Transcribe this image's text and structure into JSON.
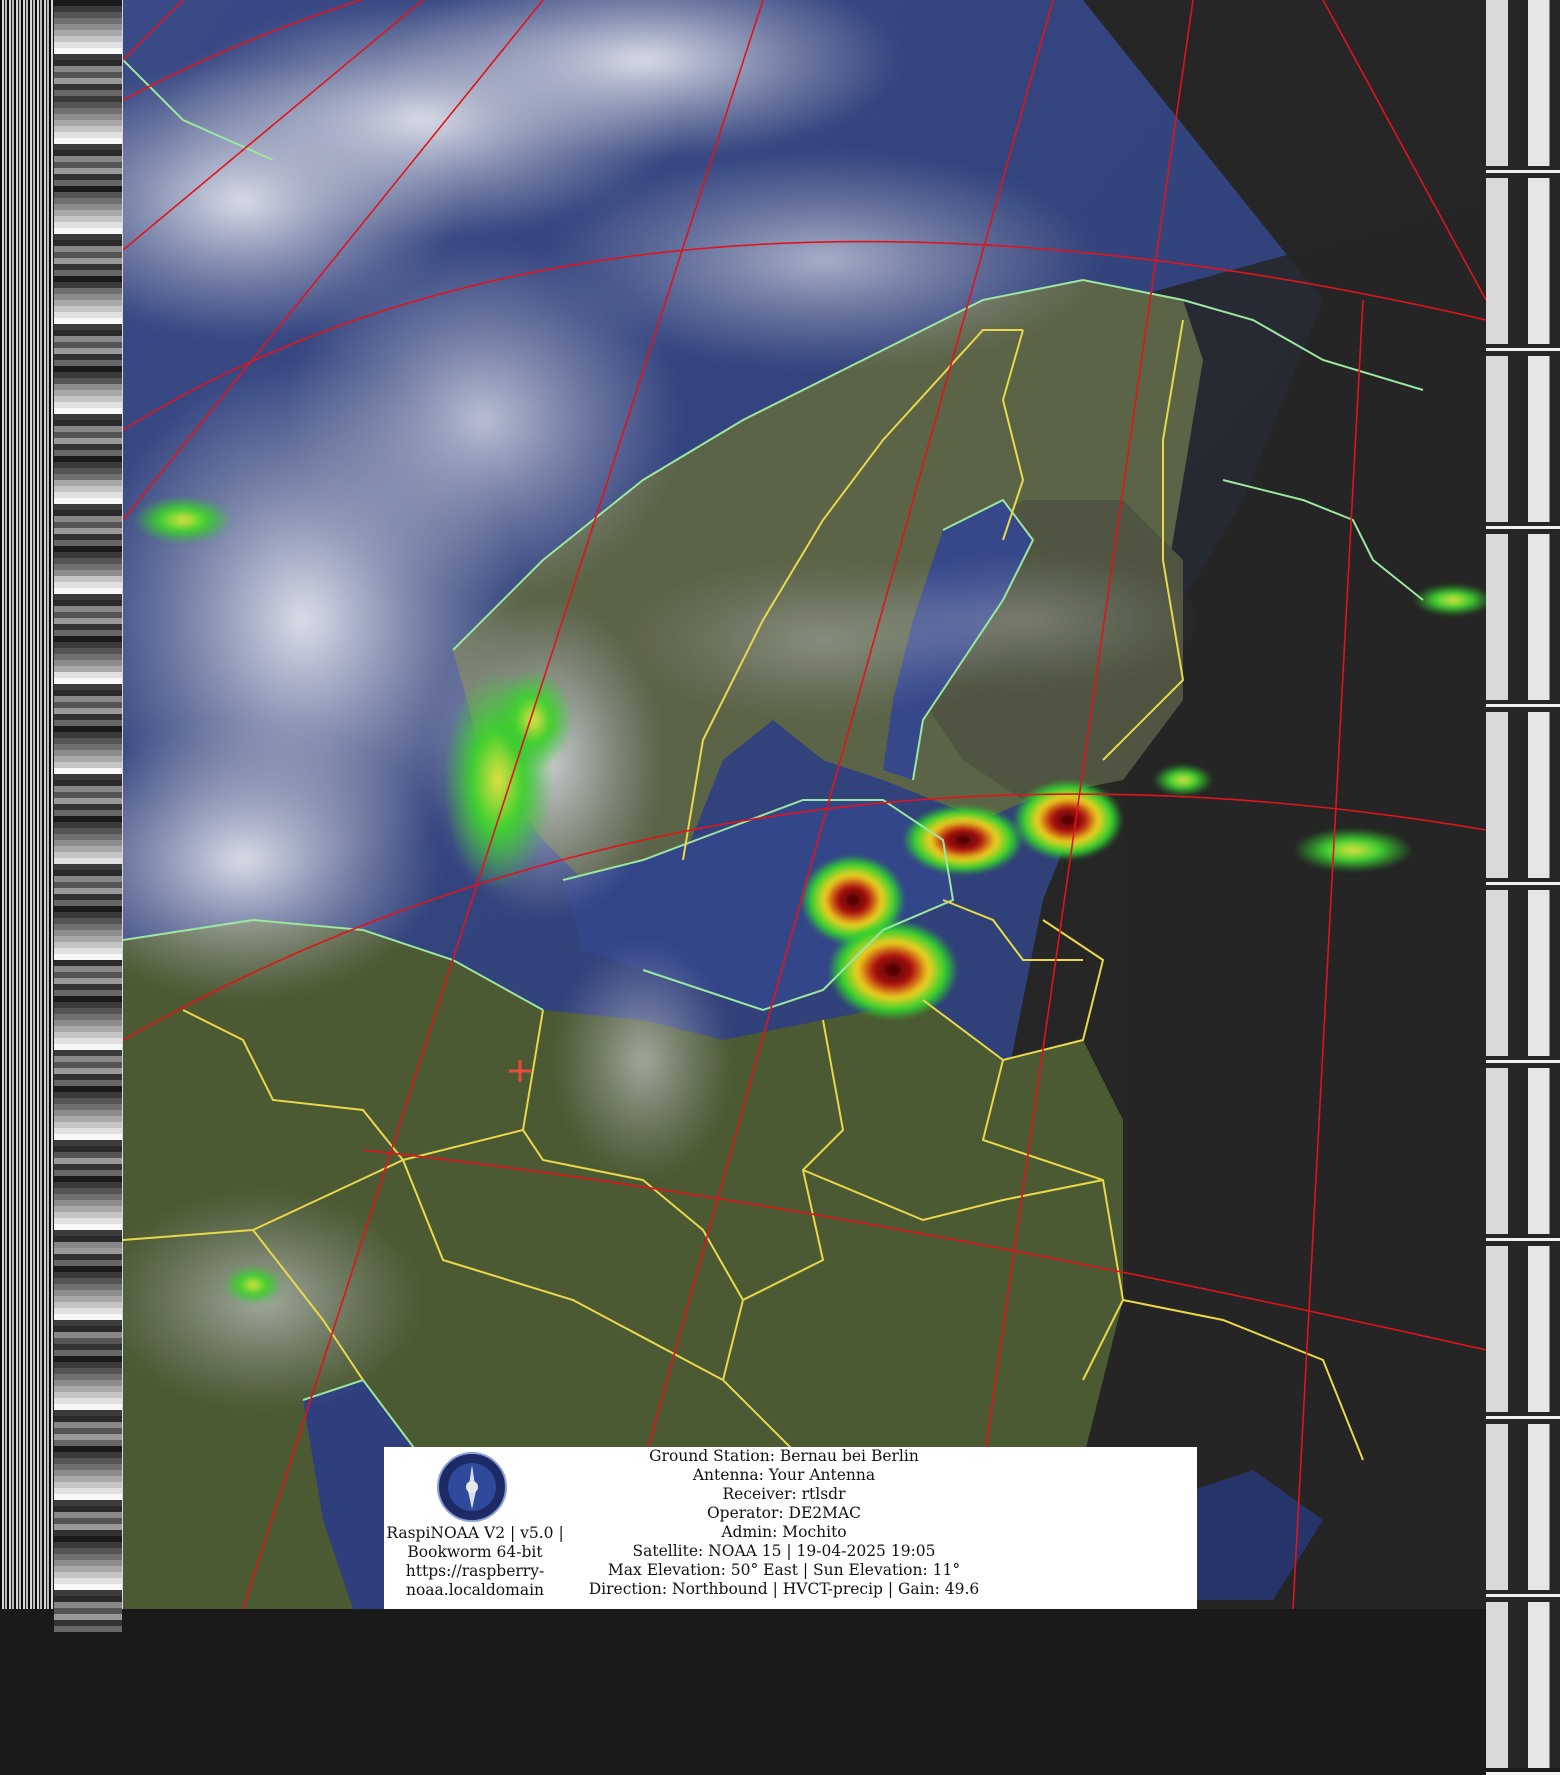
{
  "image": {
    "description_colors": {
      "ocean": "#2e3f7a",
      "land": "#4a5535",
      "cloud": "#c9ccd6",
      "night": "#262626",
      "graticule": "#e0141c",
      "border": "#e8d84a",
      "coast": "#9be6a0",
      "precip_green": "#2fd12f",
      "precip_yellow": "#f0e020",
      "precip_red": "#c81010"
    }
  },
  "info_box": {
    "software": "RaspiNOAA V2 | v5.0 | Bookworm 64-bit https://raspberry-noaa.localdomain",
    "software_lines": [
      "RaspiNOAA V2 | v5.0 |",
      "Bookworm 64-bit",
      "https://raspberry-",
      "noaa.localdomain"
    ],
    "station_lines": [
      "Ground Station: Bernau bei Berlin",
      "Antenna: Your Antenna",
      "Receiver: rtlsdr",
      "Operator: DE2MAC",
      "Admin: Mochito",
      "Satellite: NOAA 15 | 19-04-2025 19:05",
      "Max Elevation: 50° East | Sun Elevation: 11°",
      "Direction: Northbound | HVCT-precip | Gain: 49.6"
    ]
  }
}
